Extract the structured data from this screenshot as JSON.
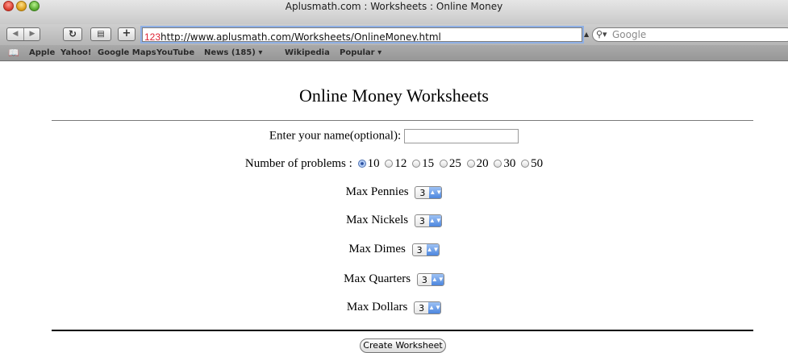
{
  "window": {
    "title": "Aplusmath.com : Worksheets : Online Money"
  },
  "toolbar": {
    "back_icon": "back-arrow-icon",
    "forward_icon": "forward-arrow-icon",
    "reload_icon": "reload-icon",
    "snapback_icon": "snapback-icon",
    "add_bookmark_label": "+",
    "address_prefix": "123",
    "address_url": "http://www.aplusmath.com/Worksheets/OnlineMoney.html",
    "search_placeholder": "Google"
  },
  "bookmarks": [
    "Apple",
    "Yahoo!",
    "Google Maps",
    "YouTube",
    "News (185) ▾",
    "Wikipedia",
    "Popular ▾"
  ],
  "page": {
    "heading": "Online Money Worksheets",
    "name_label": "Enter your name(optional):",
    "name_value": "",
    "problems_label": "Number of problems :",
    "problems_options": [
      "10",
      "12",
      "15",
      "25",
      "20",
      "30",
      "50"
    ],
    "problems_selected": "10",
    "selects": [
      {
        "label": "Max Pennies",
        "value": "3"
      },
      {
        "label": "Max Nickels",
        "value": "3"
      },
      {
        "label": "Max Dimes",
        "value": "3"
      },
      {
        "label": "Max Quarters",
        "value": "3"
      },
      {
        "label": "Max Dollars",
        "value": "3"
      }
    ],
    "submit_label": "Create Worksheet"
  }
}
